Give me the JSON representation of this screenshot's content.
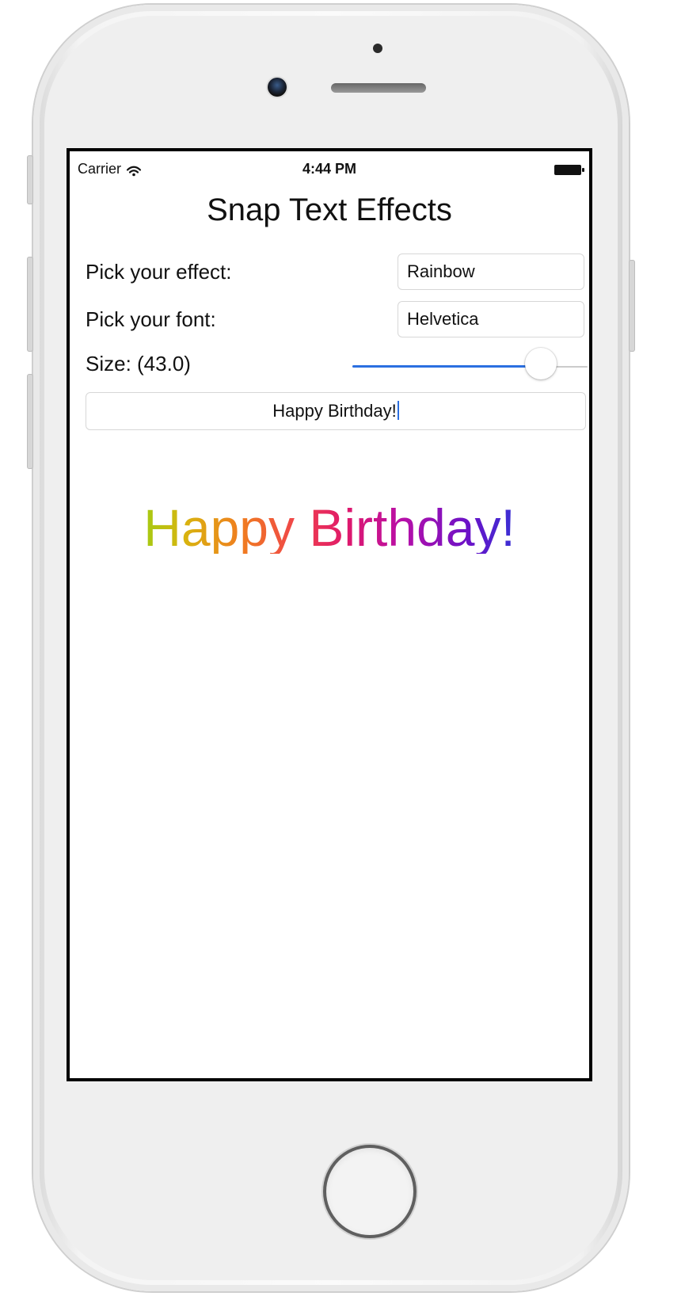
{
  "status_bar": {
    "carrier": "Carrier",
    "time": "4:44 PM"
  },
  "app": {
    "title": "Snap Text Effects",
    "effect_label": "Pick your effect:",
    "effect_value": "Rainbow",
    "font_label": "Pick your font:",
    "font_value": "Helvetica",
    "size_label": "Size: (43.0)",
    "size_slider_fraction": 0.8,
    "text_input_value": "Happy Birthday!",
    "preview_text": "Happy Birthday!"
  },
  "colors": {
    "accent": "#2B6FE0",
    "rainbow_start": "#4EDB14",
    "rainbow_end": "#1F7DE8"
  },
  "icons": {
    "wifi": "wifi-icon",
    "battery": "battery-icon",
    "camera": "front-camera-icon",
    "home": "home-button-icon"
  }
}
